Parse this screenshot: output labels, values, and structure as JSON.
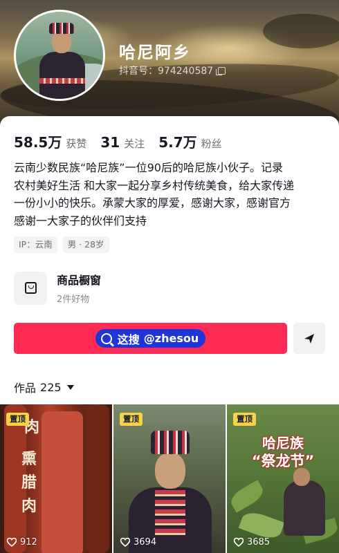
{
  "profile": {
    "nickname": "哈尼阿乡",
    "douyin_id": "抖音号：974240587",
    "stats": [
      {
        "value": "58.5万",
        "label": "获赞"
      },
      {
        "value": "31",
        "label": "关注"
      },
      {
        "value": "5.7万",
        "label": "粉丝"
      }
    ],
    "bio_lines": [
      "云南少数民族“哈尼族”一位90后的哈尼族小伙子。记录",
      "农村美好生活 和大家一起分享乡村传统美食，给大家传递",
      "一份小小的快乐。承蒙大家的厚爱，感谢大家，感谢官方",
      "感谢一大家子的伙伴们支持"
    ],
    "tags": [
      "IP：云南",
      "男 · 28岁"
    ]
  },
  "shop": {
    "title": "商品橱窗",
    "subtitle": "2件好物"
  },
  "watermark": {
    "text_a": "这搜",
    "text_b": "@zhesou"
  },
  "works": {
    "label": "作品",
    "count": "225"
  },
  "videos": [
    {
      "pin": "置顶",
      "likes": "912",
      "overlay": [
        "肉",
        "熏",
        "腊",
        "肉"
      ]
    },
    {
      "pin": "置顶",
      "likes": "3694"
    },
    {
      "pin": "置顶",
      "likes": "3685",
      "overlay": [
        "哈尼族",
        "“祭龙节”"
      ]
    }
  ],
  "colors": {
    "follow_button": "#fe2c55",
    "pin_badge": "#f8d247",
    "watermark_bg": "#1f35d8"
  },
  "icons": {
    "copy": "copy-icon",
    "shop": "shopping-bag-icon",
    "search": "search-icon",
    "send": "send-icon",
    "dropdown": "caret-down-icon",
    "like": "heart-icon"
  }
}
